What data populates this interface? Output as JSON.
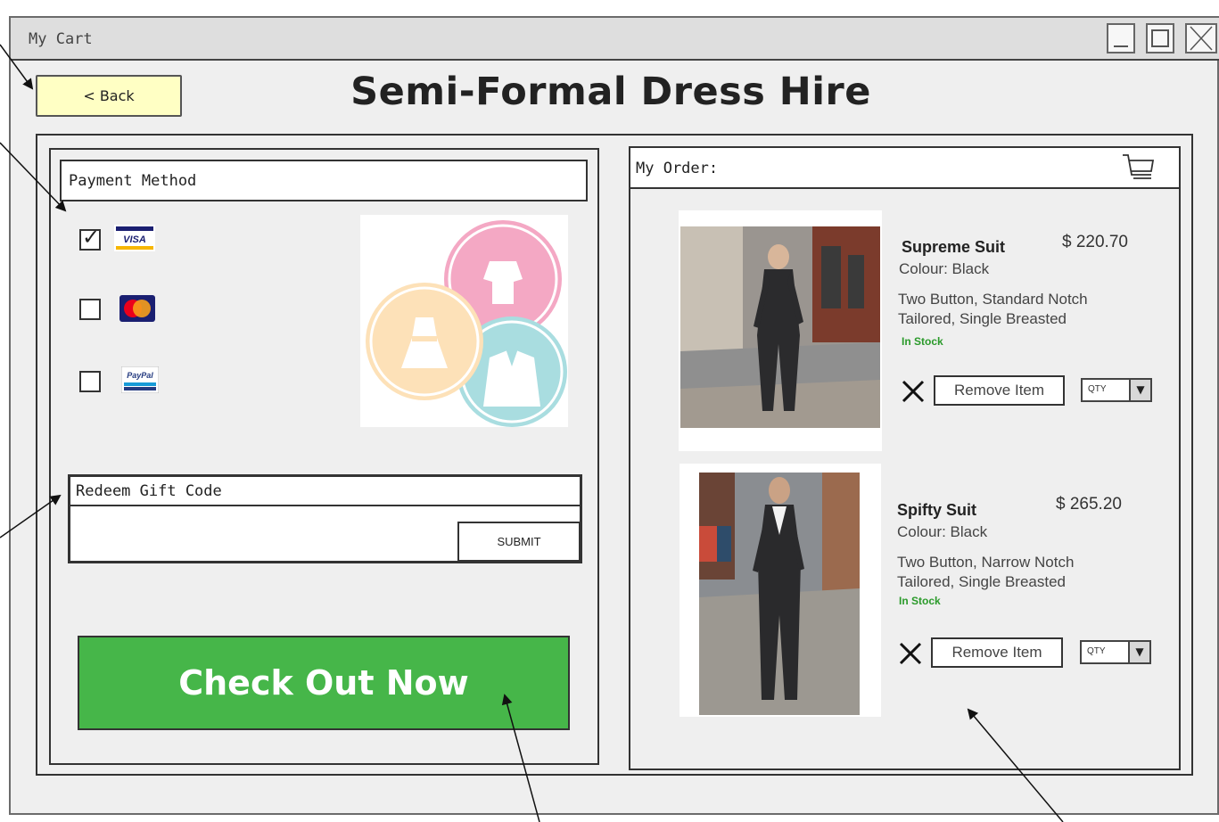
{
  "window": {
    "title": "My Cart"
  },
  "header": {
    "back_label": "< Back",
    "page_title": "Semi-Formal Dress Hire"
  },
  "payment": {
    "title": "Payment Method",
    "methods": [
      {
        "name": "VISA",
        "checked": true
      },
      {
        "name": "MasterCard",
        "checked": false
      },
      {
        "name": "PayPal",
        "checked": false
      }
    ],
    "check_mark": "✓"
  },
  "gift": {
    "label": "Redeem Gift Code",
    "input_value": "",
    "submit_label": "SUBMIT"
  },
  "checkout": {
    "label": "Check Out Now",
    "color": "#46b649"
  },
  "order": {
    "title": "My Order:",
    "items": [
      {
        "name": "Supreme Suit",
        "price": "$ 220.70",
        "colour": "Colour: Black",
        "desc1": "Two Button, Standard Notch",
        "desc2": "Tailored, Single Breasted",
        "stock": "In Stock",
        "remove_label": "Remove Item",
        "qty_label": "QTY"
      },
      {
        "name": "Spifty Suit",
        "price": "$ 265.20",
        "colour": "Colour: Black",
        "desc1": "Two Button, Narrow Notch",
        "desc2": "Tailored, Single Breasted",
        "stock": "In Stock",
        "remove_label": "Remove Item",
        "qty_label": "QTY"
      }
    ]
  },
  "colors": {
    "back_button": "#ffffc4",
    "stock_green": "#2a9a2a"
  }
}
